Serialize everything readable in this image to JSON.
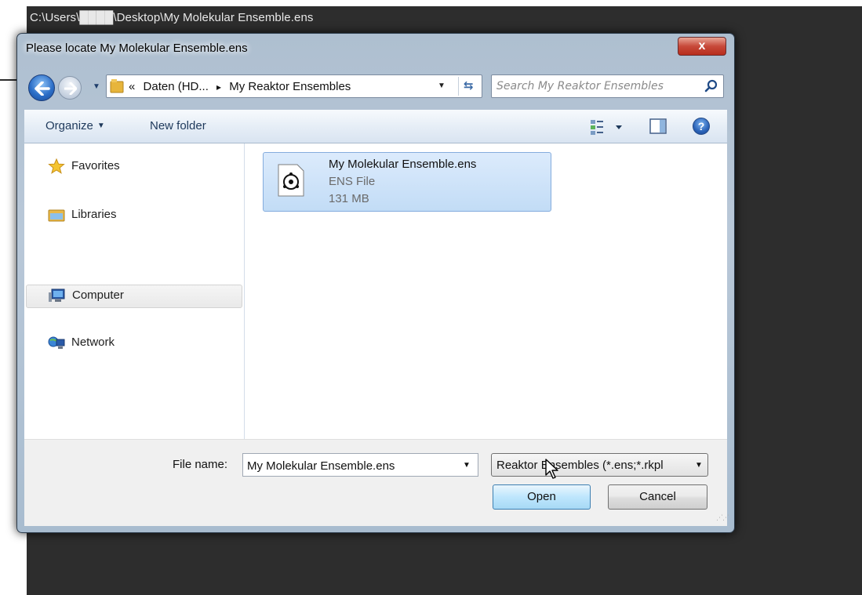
{
  "host": {
    "path": "C:\\Users\\████\\Desktop\\My Molekular Ensemble.ens"
  },
  "dialog": {
    "title": "Please locate My Molekular Ensemble.ens",
    "close_label": "x"
  },
  "address": {
    "prefix": "«",
    "crumbs": [
      "Daten (HD...",
      "My Reaktor Ensembles"
    ],
    "separator": "▸"
  },
  "search": {
    "placeholder": "Search My Reaktor Ensembles"
  },
  "toolbar": {
    "organize": "Organize",
    "new_folder": "New folder",
    "help": "?"
  },
  "nav": {
    "items": [
      {
        "label": "Favorites",
        "icon": "star-icon"
      },
      {
        "label": "Libraries",
        "icon": "library-icon"
      },
      {
        "label": "Computer",
        "icon": "computer-icon"
      },
      {
        "label": "Network",
        "icon": "network-icon"
      }
    ],
    "selected": "Computer"
  },
  "file": {
    "name": "My Molekular Ensemble.ens",
    "type": "ENS File",
    "size": "131 MB"
  },
  "bottom": {
    "file_name_label": "File name:",
    "file_name_value": "My Molekular Ensemble.ens",
    "filter_value": "Reaktor Ensembles (*.ens;*.rkpl",
    "open_label": "Open",
    "cancel_label": "Cancel"
  }
}
